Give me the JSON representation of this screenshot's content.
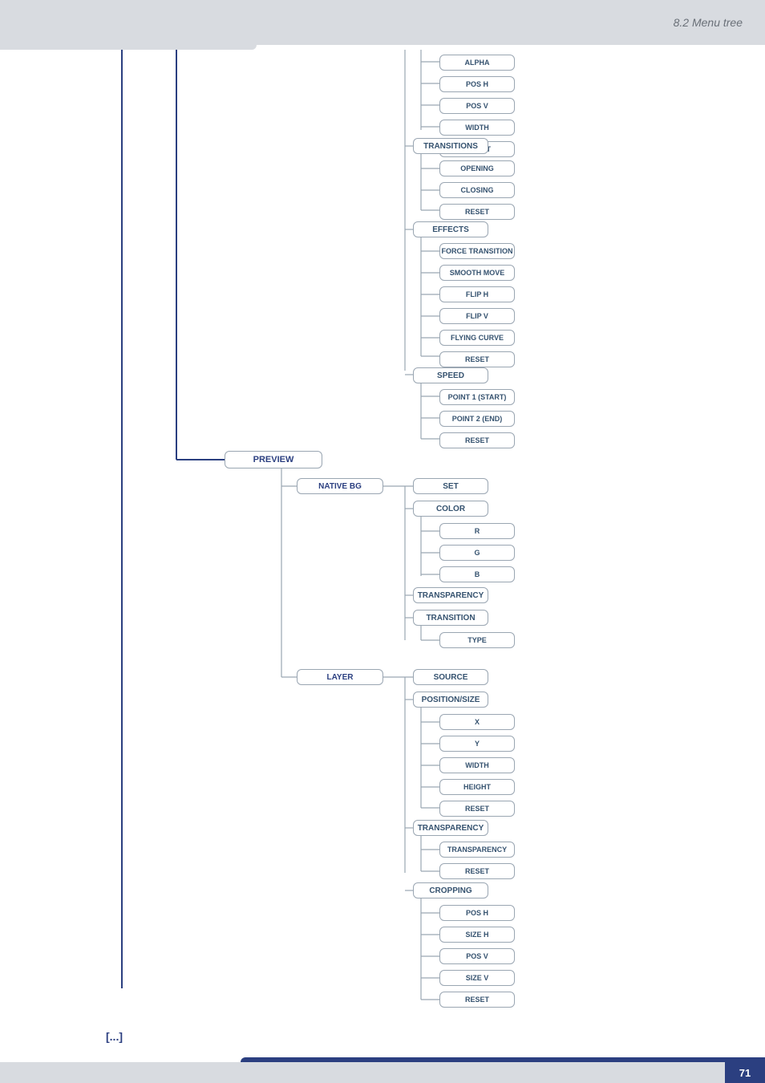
{
  "header": {
    "breadcrumb": "8.2 Menu tree"
  },
  "footer": {
    "page": "71"
  },
  "continuation": "[...]",
  "tree": {
    "level2_preview": "PREVIEW",
    "level3": {
      "native_bg": "NATIVE BG",
      "layer": "LAYER"
    },
    "col4_group1": [
      "ALPHA",
      "POS H",
      "POS V",
      "WIDTH",
      "HEIGHT"
    ],
    "col4_head": {
      "transitions": "TRANSITIONS",
      "effects": "EFFECTS",
      "speed": "SPEED",
      "set": "SET",
      "color": "COLOR",
      "transparency1": "TRANSPARENCY",
      "transition": "TRANSITION",
      "source": "SOURCE",
      "position_size": "POSITION/SIZE",
      "transparency2": "TRANSPARENCY",
      "cropping": "CROPPING"
    },
    "col5": {
      "transitions": [
        "OPENING",
        "CLOSING",
        "RESET"
      ],
      "effects": [
        "FORCE TRANSITION",
        "SMOOTH MOVE",
        "FLIP H",
        "FLIP V",
        "FLYING CURVE",
        "RESET"
      ],
      "speed": [
        "POINT 1 (START)",
        "POINT 2 (END)",
        "RESET"
      ],
      "color": [
        "R",
        "G",
        "B"
      ],
      "transition": [
        "TYPE"
      ],
      "position_size": [
        "X",
        "Y",
        "WIDTH",
        "HEIGHT",
        "RESET"
      ],
      "transparency": [
        "TRANSPARENCY",
        "RESET"
      ],
      "cropping": [
        "POS H",
        "SIZE H",
        "POS V",
        "SIZE V",
        "RESET"
      ]
    }
  }
}
